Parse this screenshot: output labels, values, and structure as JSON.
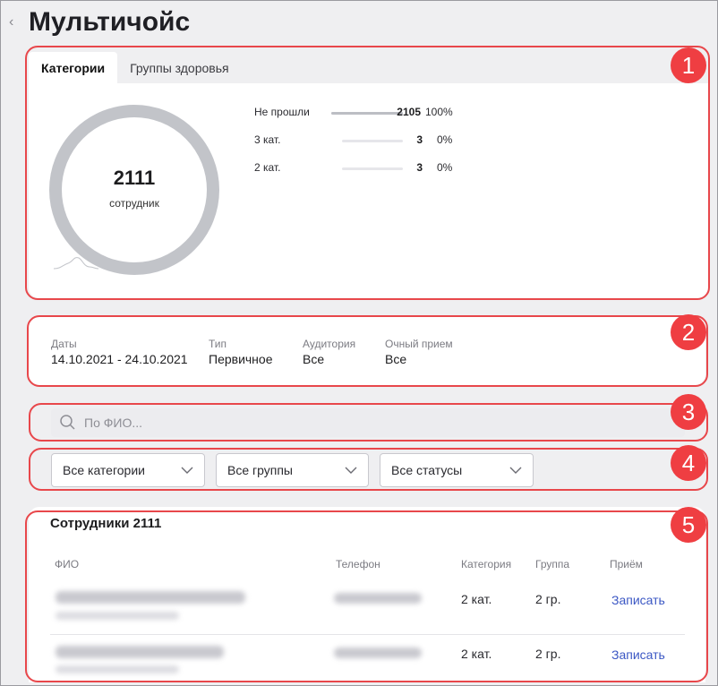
{
  "header": {
    "back_icon": "chevron-left-icon",
    "title": "Мультичойс"
  },
  "badges": [
    "1",
    "2",
    "3",
    "4",
    "5"
  ],
  "categories_card": {
    "tabs": [
      {
        "label": "Категории",
        "active": true
      },
      {
        "label": "Группы здоровья",
        "active": false
      }
    ],
    "donut": {
      "value": "2111",
      "caption": "сотрудник",
      "color": "#c2c4c9"
    },
    "legend": [
      {
        "label": "Не прошли",
        "count": "2105",
        "percent": "100%",
        "fill": 1.0
      },
      {
        "label": "3 кат.",
        "count": "3",
        "percent": "0%",
        "fill": 0.0
      },
      {
        "label": "2 кат.",
        "count": "3",
        "percent": "0%",
        "fill": 0.0
      }
    ]
  },
  "filters_info": [
    {
      "key": "Даты",
      "value": "14.10.2021 - 24.10.2021"
    },
    {
      "key": "Тип",
      "value": "Первичное"
    },
    {
      "key": "Аудитория",
      "value": "Все"
    },
    {
      "key": "Очный прием",
      "value": "Все"
    }
  ],
  "search": {
    "placeholder": "По ФИО...",
    "icon": "search-icon"
  },
  "selects": [
    {
      "value": "Все категории"
    },
    {
      "value": "Все группы"
    },
    {
      "value": "Все статусы"
    }
  ],
  "employees": {
    "title": "Сотрудники 2111",
    "columns": [
      "ФИО",
      "Телефон",
      "Категория",
      "Группа",
      "Приём"
    ],
    "rows": [
      {
        "category": "2 кат.",
        "group": "2 гр.",
        "action": "Записать"
      },
      {
        "category": "2 кат.",
        "group": "2 гр.",
        "action": "Записать"
      }
    ]
  },
  "colors": {
    "highlight": "#e8474b",
    "badge": "#ef3e42",
    "link": "#3b57c4"
  }
}
